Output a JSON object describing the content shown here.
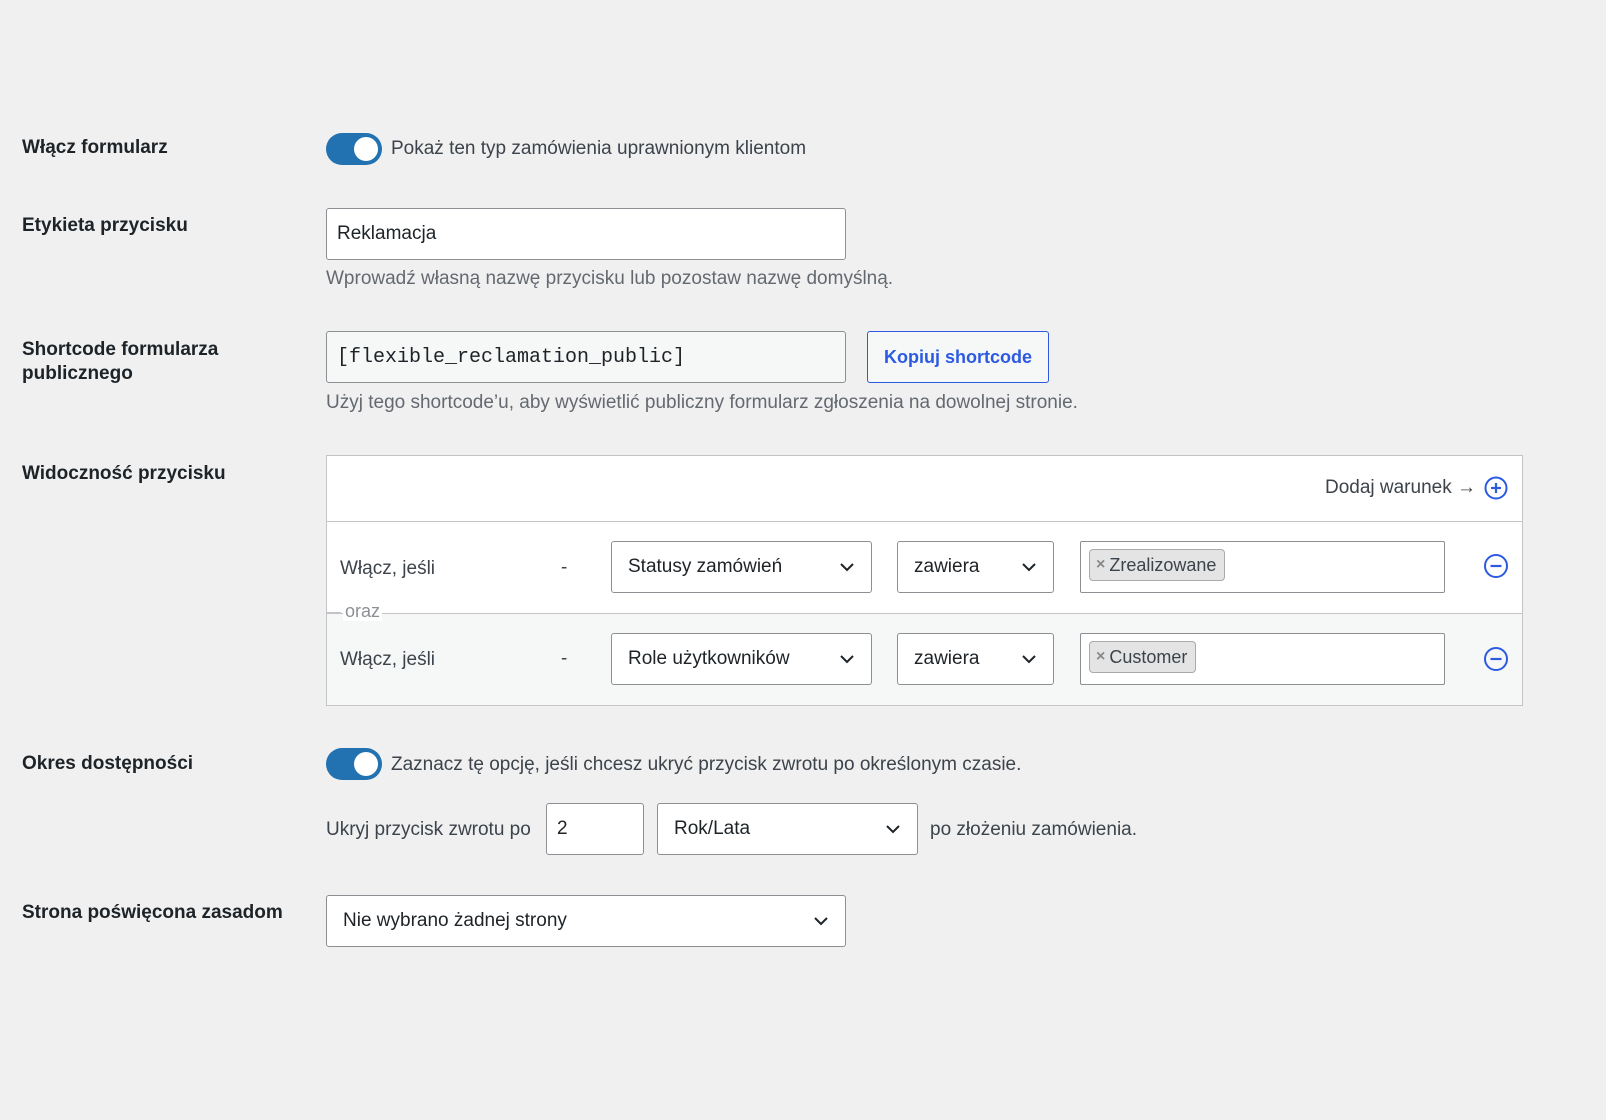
{
  "enable_form": {
    "label": "Włącz formularz",
    "toggle_on": true,
    "description": "Pokaż ten typ zamówienia uprawnionym klientom"
  },
  "button_label": {
    "label": "Etykieta przycisku",
    "value": "Reklamacja",
    "help": "Wprowadź własną nazwę przycisku lub pozostaw nazwę domyślną."
  },
  "shortcode": {
    "label": "Shortcode formularza publicznego",
    "value": "[flexible_reclamation_public]",
    "copy_button": "Kopiuj shortcode",
    "help": "Użyj tego shortcode’u, aby wyświetlić publiczny formularz zgłoszenia na dowolnej stronie."
  },
  "visibility": {
    "label": "Widoczność przycisku",
    "add_condition": "Dodaj warunek →",
    "joiner": "oraz",
    "conditions": [
      {
        "prefix": "Włącz, jeśli",
        "dash": "-",
        "field": "Statusy zamówień",
        "operator": "zawiera",
        "tag": "Zrealizowane"
      },
      {
        "prefix": "Włącz, jeśli",
        "dash": "-",
        "field": "Role użytkowników",
        "operator": "zawiera",
        "tag": "Customer"
      }
    ]
  },
  "availability": {
    "label": "Okres dostępności",
    "toggle_on": true,
    "description": "Zaznacz tę opcję, jeśli chcesz ukryć przycisk zwrotu po określonym czasie.",
    "hide_prefix": "Ukryj przycisk zwrotu po",
    "amount": "2",
    "unit": "Rok/Lata",
    "hide_suffix": "po złożeniu zamówienia."
  },
  "policy_page": {
    "label": "Strona poświęcona zasadom",
    "selected": "Nie wybrano żadnej strony"
  },
  "colors": {
    "toggle": "#2271b1",
    "accent": "#2c5ae0",
    "background": "#f0f0f1"
  }
}
